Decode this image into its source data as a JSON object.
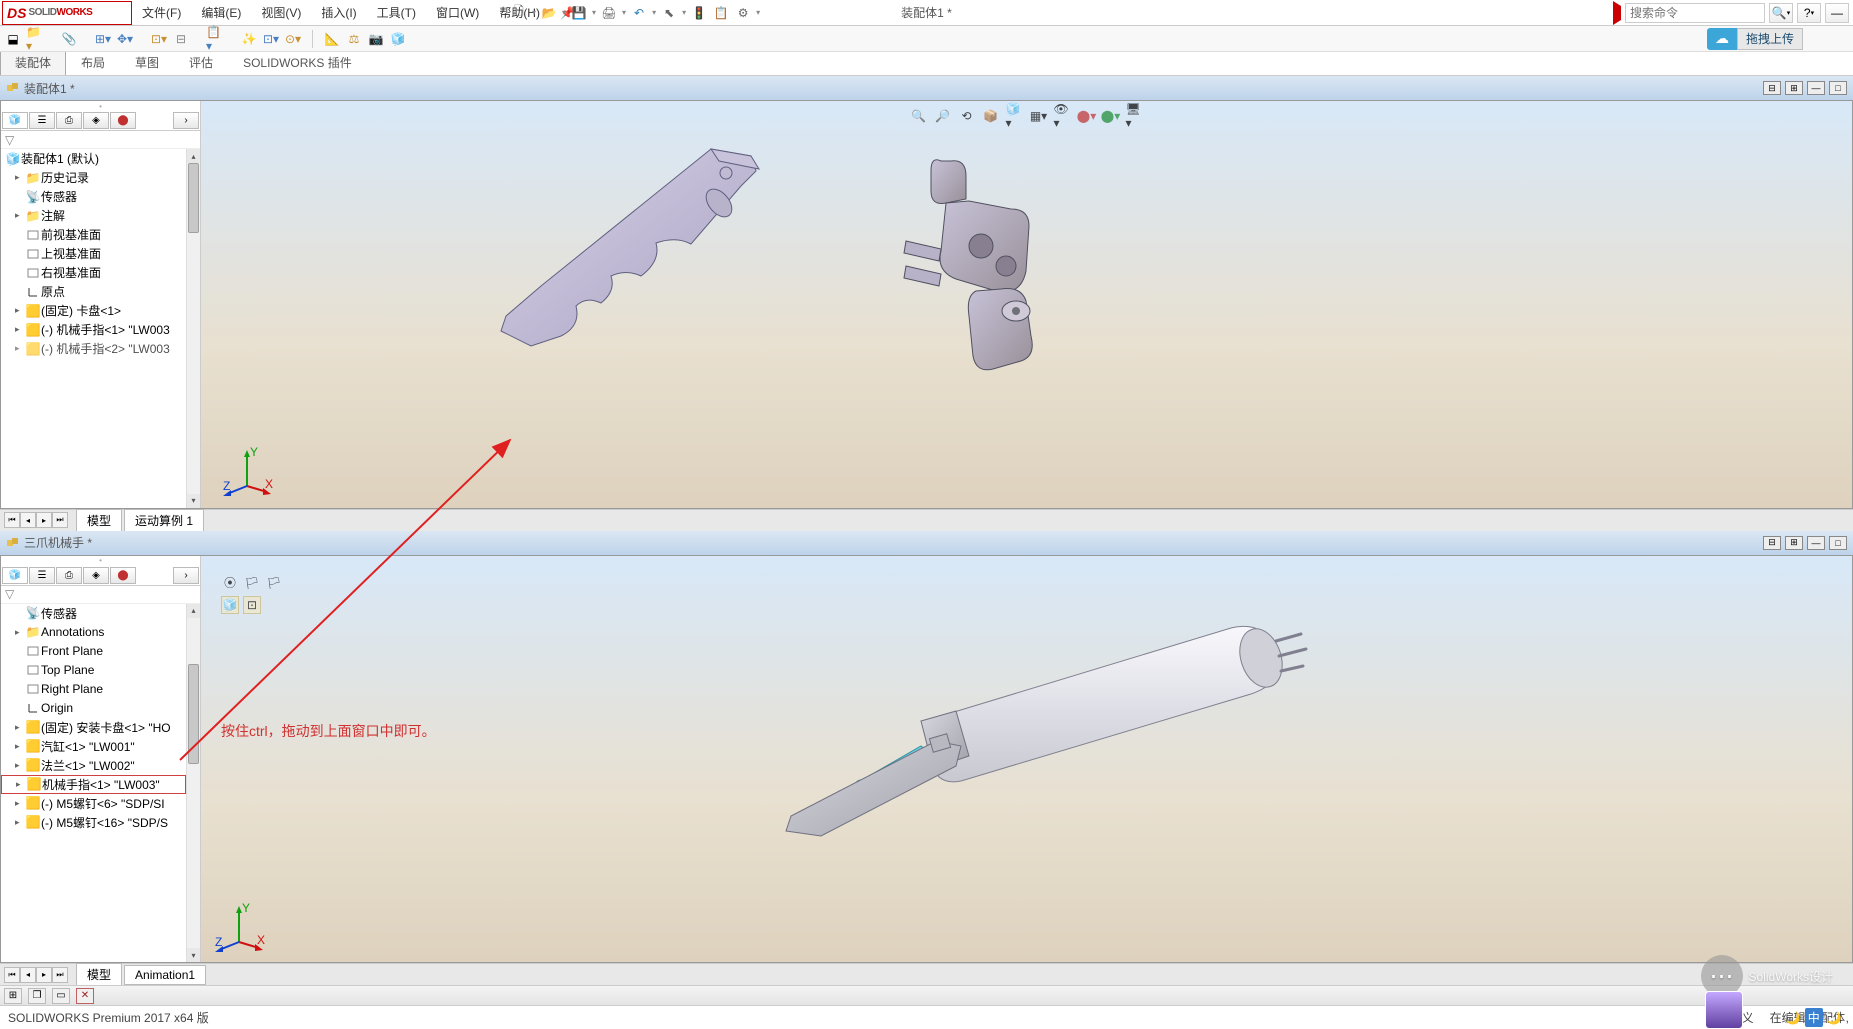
{
  "app": {
    "logo_ds": "DS",
    "logo_solid": "SOLID",
    "logo_works": "WORKS"
  },
  "menu": {
    "file": "文件(F)",
    "edit": "编辑(E)",
    "view": "视图(V)",
    "insert": "插入(I)",
    "tools": "工具(T)",
    "window": "窗口(W)",
    "help": "帮助(H)"
  },
  "title_center": "装配体1 *",
  "search_placeholder": "搜索命令",
  "upload_label": "拖拽上传",
  "cmd_tabs": {
    "assembly": "装配体",
    "layout": "布局",
    "sketch": "草图",
    "evaluate": "评估",
    "addins": "SOLIDWORKS 插件"
  },
  "doc1": {
    "tab": "装配体1 *",
    "tree": {
      "root": "装配体1 (默认)",
      "history": "历史记录",
      "sensors": "传感器",
      "annotations": "注解",
      "front": "前视基准面",
      "top": "上视基准面",
      "right": "右视基准面",
      "origin": "原点",
      "p1": "(固定) 卡盘<1>",
      "p2": "(-) 机械手指<1> \"LW003",
      "p3": "(-) 机械手指<2> \"LW003"
    },
    "btabs": {
      "model": "模型",
      "motion": "运动算例 1"
    }
  },
  "doc2": {
    "tab": "三爪机械手 *",
    "tree": {
      "sensors": "传感器",
      "annotations": "Annotations",
      "front": "Front Plane",
      "top": "Top Plane",
      "right": "Right Plane",
      "origin": "Origin",
      "p1": "(固定) 安装卡盘<1> \"HO",
      "p2": "汽缸<1> \"LW001\"",
      "p3": "法兰<1> \"LW002\"",
      "p4": "机械手指<1> \"LW003\"",
      "p5": "(-) M5螺钉<6> \"SDP/SI",
      "p6": "(-) M5螺钉<16> \"SDP/S"
    },
    "btabs": {
      "model": "模型",
      "anim": "Animation1"
    }
  },
  "annotation": "按住ctrl，拖动到上面窗口中即可。",
  "status": {
    "version": "SOLIDWORKS Premium 2017 x64 版",
    "under_defined": "欠定义",
    "editing": "在编辑 装配体",
    "ime": "中"
  },
  "watermark": "SolidWorks设计"
}
